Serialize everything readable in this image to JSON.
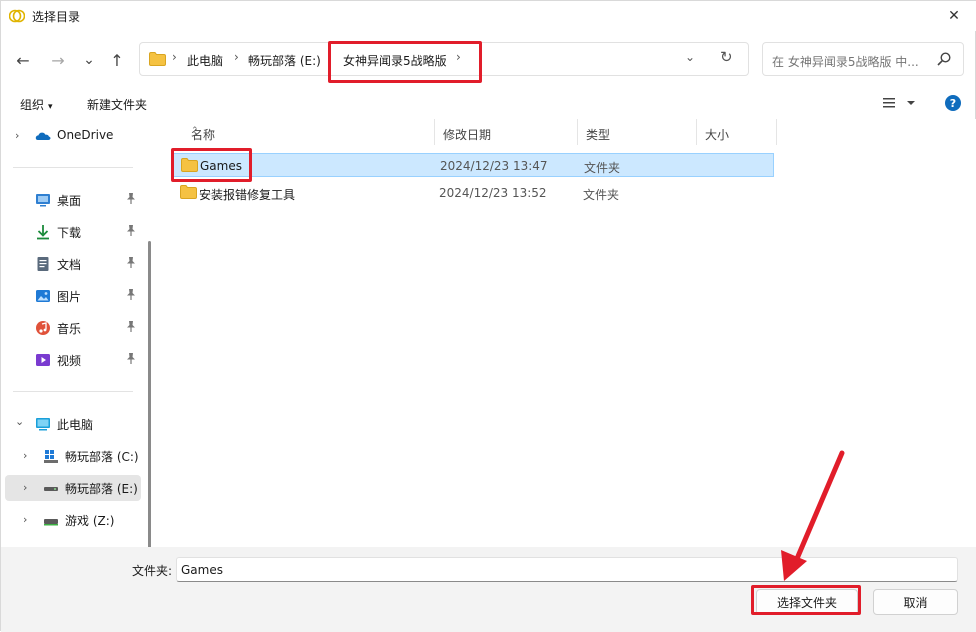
{
  "window": {
    "title": "选择目录",
    "close_glyph": "✕"
  },
  "nav": {
    "back_glyph": "←",
    "forward_glyph": "→",
    "recent_glyph": "⌄",
    "up_glyph": "↑",
    "breadcrumbs": [
      "此电脑",
      "畅玩部落 (E:)",
      "女神异闻录5战略版"
    ],
    "crumb_sep": "›",
    "dropdown_glyph": "⌄",
    "refresh_glyph": "↻",
    "search_placeholder": "在 女神异闻录5战略版 中..."
  },
  "toolbar": {
    "organize": "组织",
    "new_folder": "新建文件夹",
    "caret": "▾",
    "help": "?"
  },
  "sidebar": {
    "onedrive": "OneDrive",
    "quick": [
      {
        "label": "桌面",
        "icon": "desktop-icon",
        "color": "#2f7fd1"
      },
      {
        "label": "下载",
        "icon": "download-icon",
        "color": "#1b8b3b"
      },
      {
        "label": "文档",
        "icon": "document-icon",
        "color": "#5a6a7c"
      },
      {
        "label": "图片",
        "icon": "pictures-icon",
        "color": "#1f7ad6"
      },
      {
        "label": "音乐",
        "icon": "music-icon",
        "color": "#e0523a"
      },
      {
        "label": "视频",
        "icon": "video-icon",
        "color": "#7a3bd0"
      }
    ],
    "pin_glyph": "📌",
    "this_pc": "此电脑",
    "drives": [
      {
        "label": "畅玩部落 (C:)",
        "icon": "windows-drive-icon"
      },
      {
        "label": "畅玩部落 (E:)",
        "icon": "drive-icon"
      },
      {
        "label": "游戏 (Z:)",
        "icon": "drive-icon"
      }
    ],
    "chevron_right": "›",
    "chevron_down": "⌄"
  },
  "list": {
    "columns": [
      "名称",
      "修改日期",
      "类型",
      "大小"
    ],
    "sort_glyph": "⌃",
    "rows": [
      {
        "name": "Games",
        "modified": "2024/12/23 13:47",
        "type": "文件夹"
      },
      {
        "name": "安装报错修复工具",
        "modified": "2024/12/23 13:52",
        "type": "文件夹"
      }
    ]
  },
  "footer": {
    "field_label": "文件夹:",
    "field_value": "Games",
    "select_button": "选择文件夹",
    "cancel_button": "取消"
  },
  "colors": {
    "accent": "#0f6cbd",
    "highlight": "#e11d2a",
    "selection": "#cce8ff",
    "folder": "#f5c242"
  }
}
